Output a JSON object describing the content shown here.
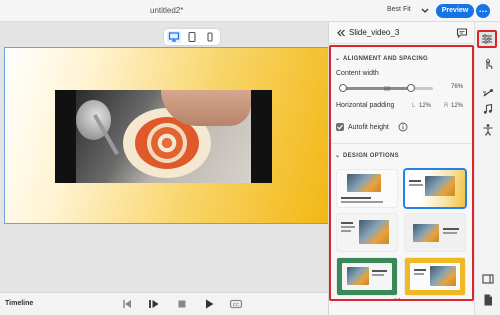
{
  "topbar": {
    "doc_title": "untitled2*",
    "fit_label": "Best Fit",
    "preview_label": "Preview",
    "more_label": "…"
  },
  "device_modes": [
    {
      "name": "desktop-icon",
      "active": true
    },
    {
      "name": "tablet-icon",
      "active": false
    },
    {
      "name": "mobile-icon",
      "active": false
    }
  ],
  "panel": {
    "title": "Slide_video_3",
    "alignment": {
      "heading": "ALIGNMENT AND SPACING",
      "content_width_label": "Content width",
      "content_width_value": "76%",
      "content_width_percent": 76,
      "horizontal_padding_label": "Horizontal padding",
      "padding_left_label": "L",
      "padding_left_value": "12%",
      "padding_right_label": "R",
      "padding_right_value": "12%",
      "autofit_label": "Autofit height",
      "autofit_checked": true
    },
    "design": {
      "heading": "DESIGN OPTIONS",
      "selected_index": 1
    }
  },
  "timeline": {
    "label": "Timeline",
    "cc_label": "CC"
  },
  "scroll_indicator": "••",
  "colors": {
    "accent": "#1473e6",
    "highlight": "#d9262c",
    "gradient_end": "#f2b713"
  }
}
